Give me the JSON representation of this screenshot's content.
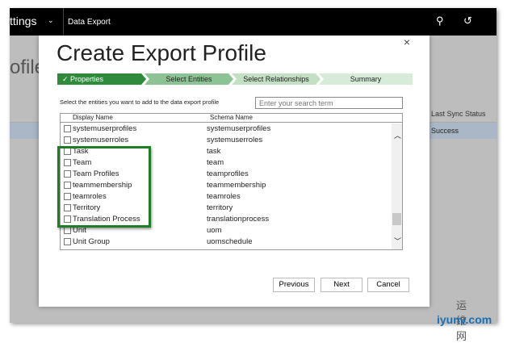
{
  "topbar": {
    "app": "ttings",
    "crumb": "Data Export"
  },
  "background": {
    "title": "ofile",
    "col_last_sync": "Last Sync Status",
    "row_status": "Success"
  },
  "dialog": {
    "title": "Create Export Profile",
    "close": "×",
    "steps": [
      {
        "label": "✓ Properties"
      },
      {
        "label": "Select Entities"
      },
      {
        "label": "Select Relationships"
      },
      {
        "label": "Summary"
      }
    ],
    "instruction": "Select the entities you want to add to the data export profile",
    "search_placeholder": "Enter your search term",
    "columns": {
      "display": "Display Name",
      "schema": "Schema Name"
    },
    "rows": [
      {
        "d": "systemuserprofiles",
        "s": "systemuserprofiles"
      },
      {
        "d": "systemuserroles",
        "s": "systemuserroles"
      },
      {
        "d": "Task",
        "s": "task"
      },
      {
        "d": "Team",
        "s": "team"
      },
      {
        "d": "Team Profiles",
        "s": "teamprofiles"
      },
      {
        "d": "teammembership",
        "s": "teammembership"
      },
      {
        "d": "teamroles",
        "s": "teamroles"
      },
      {
        "d": "Territory",
        "s": "territory"
      },
      {
        "d": "Translation Process",
        "s": "translationprocess"
      },
      {
        "d": "Unit",
        "s": "uom"
      },
      {
        "d": "Unit Group",
        "s": "uomschedule"
      }
    ],
    "buttons": {
      "previous": "Previous",
      "next": "Next",
      "cancel": "Cancel"
    }
  },
  "watermark": {
    "cn": "运维网",
    "site": "iyunv.com"
  }
}
